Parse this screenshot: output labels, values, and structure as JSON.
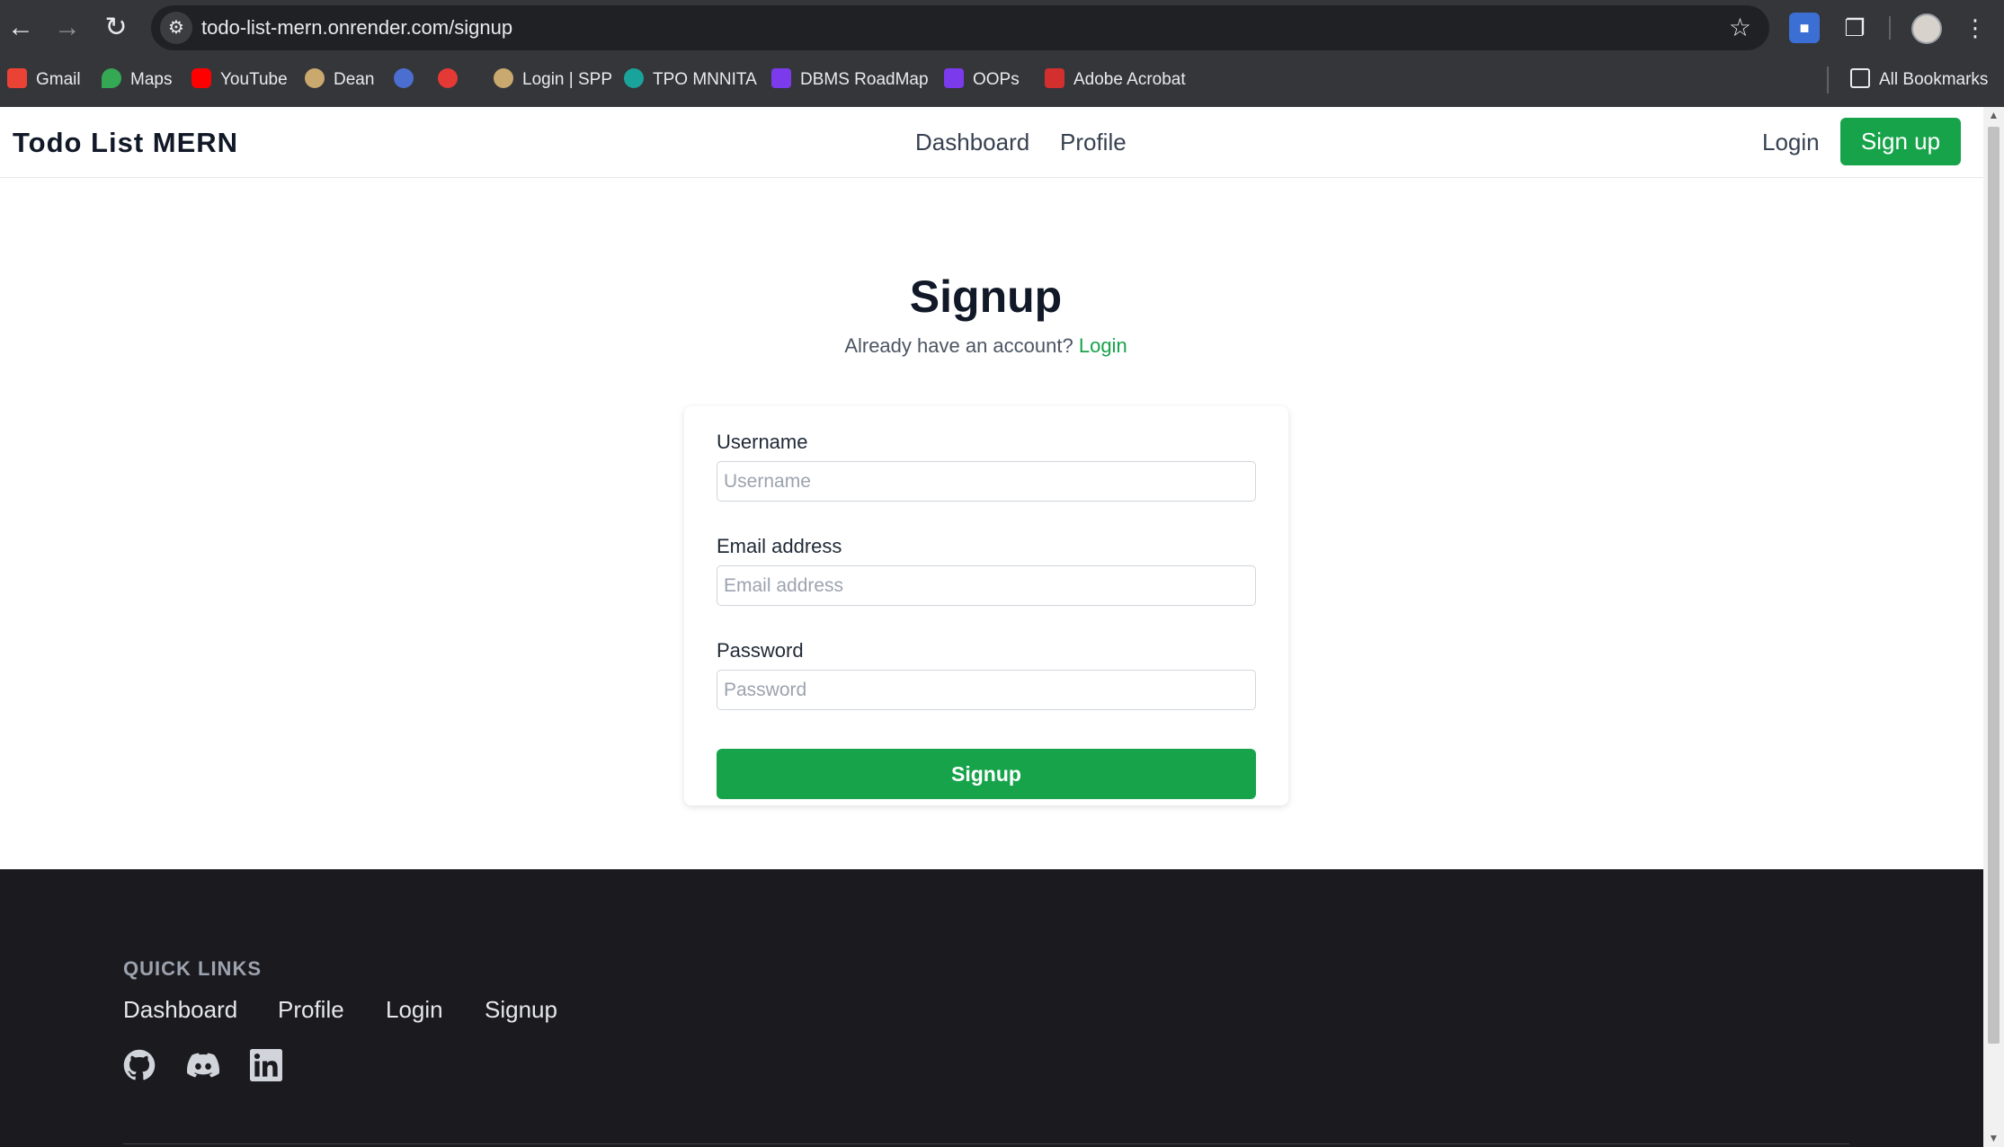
{
  "browser": {
    "url": "todo-list-mern.onrender.com/signup",
    "bookmarks": [
      {
        "label": "Gmail",
        "icon": "gmail-icon",
        "color": "#ea4335"
      },
      {
        "label": "Maps",
        "icon": "maps-icon",
        "color": "#34a853"
      },
      {
        "label": "YouTube",
        "icon": "youtube-icon",
        "color": "#ff0000"
      },
      {
        "label": "Dean",
        "icon": "dean-icon",
        "color": "#c9a96e"
      },
      {
        "label": "",
        "icon": "site-icon",
        "color": "#4a6fd1"
      },
      {
        "label": "",
        "icon": "tuf-icon",
        "color": "#e53935"
      },
      {
        "label": "Login | SPP",
        "icon": "spp-icon",
        "color": "#c9a96e"
      },
      {
        "label": "TPO MNNITA",
        "icon": "tpo-icon",
        "color": "#1aa39a"
      },
      {
        "label": "DBMS RoadMap",
        "icon": "dbms-icon",
        "color": "#7c3aed"
      },
      {
        "label": "OOPs",
        "icon": "oops-icon",
        "color": "#7c3aed"
      },
      {
        "label": "Adobe Acrobat",
        "icon": "acrobat-icon",
        "color": "#d32f2f"
      }
    ],
    "all_bookmarks": "All Bookmarks"
  },
  "navbar": {
    "brand": "Todo List MERN",
    "links": [
      "Dashboard",
      "Profile"
    ],
    "login": "Login",
    "signup": "Sign up"
  },
  "main": {
    "title": "Signup",
    "prompt": "Already have an account?",
    "login_link": "Login"
  },
  "form": {
    "username_label": "Username",
    "username_placeholder": "Username",
    "email_label": "Email address",
    "email_placeholder": "Email address",
    "password_label": "Password",
    "password_placeholder": "Password",
    "submit": "Signup"
  },
  "footer": {
    "quick_links_title": "QUICK LINKS",
    "links": [
      "Dashboard",
      "Profile",
      "Login",
      "Signup"
    ],
    "social": [
      "github-icon",
      "discord-icon",
      "linkedin-icon"
    ]
  },
  "colors": {
    "accent": "#16a34a",
    "footer_bg": "#1b1b1f",
    "chrome_bg": "#35363a"
  }
}
